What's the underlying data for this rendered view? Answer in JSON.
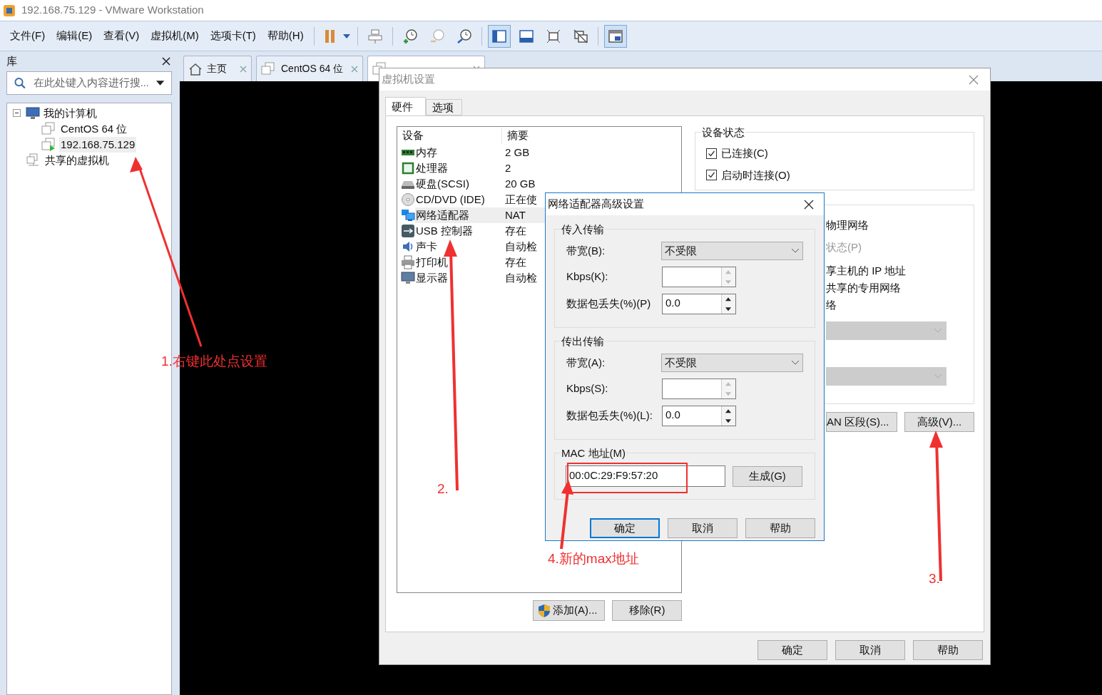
{
  "window": {
    "title": "192.168.75.129 - VMware Workstation"
  },
  "menu": [
    {
      "label": "文件(F)"
    },
    {
      "label": "编辑(E)"
    },
    {
      "label": "查看(V)"
    },
    {
      "label": "虚拟机(M)"
    },
    {
      "label": "选项卡(T)"
    },
    {
      "label": "帮助(H)"
    }
  ],
  "library": {
    "title": "库",
    "search": {
      "placeholder": "在此处键入内容进行搜..."
    },
    "tree": [
      {
        "label": "我的计算机",
        "kind": "computer",
        "expanded": true,
        "selected": false,
        "children": [
          {
            "label": "CentOS 64 位",
            "kind": "vm",
            "running": false,
            "selected": false
          },
          {
            "label": "192.168.75.129",
            "kind": "vm",
            "running": true,
            "selected": true
          }
        ]
      },
      {
        "label": "共享的虚拟机",
        "kind": "shared",
        "selected": false
      }
    ]
  },
  "tabs": [
    {
      "label": "主页",
      "kind": "home",
      "selected": false
    },
    {
      "label": "CentOS 64 位",
      "kind": "vm",
      "selected": false
    },
    {
      "kind": "vm",
      "selected": true
    }
  ],
  "settings_dialog": {
    "title": "虚拟机设置",
    "tabs": [
      {
        "label": "硬件",
        "selected": true
      },
      {
        "label": "选项",
        "selected": false
      }
    ],
    "devices": {
      "columns": [
        "设备",
        "摘要"
      ],
      "rows": [
        {
          "device": "内存",
          "summary": "2 GB",
          "kind": "memory",
          "selected": false
        },
        {
          "device": "处理器",
          "summary": "2",
          "kind": "cpu",
          "selected": false
        },
        {
          "device": "硬盘(SCSI)",
          "summary": "20 GB",
          "kind": "disk",
          "selected": false
        },
        {
          "device": "CD/DVD (IDE)",
          "summary": "正在使",
          "kind": "cd",
          "selected": false
        },
        {
          "device": "网络适配器",
          "summary": "NAT",
          "kind": "network",
          "selected": true
        },
        {
          "device": "USB 控制器",
          "summary": "存在",
          "kind": "usb",
          "selected": false
        },
        {
          "device": "声卡",
          "summary": "自动检",
          "kind": "sound",
          "selected": false
        },
        {
          "device": "打印机",
          "summary": "存在",
          "kind": "printer",
          "selected": false
        },
        {
          "device": "显示器",
          "summary": "自动检",
          "kind": "display",
          "selected": false
        }
      ]
    },
    "list_buttons": [
      "添加(A)...",
      "移除(R)"
    ],
    "device_status": {
      "title": "设备状态",
      "options": [
        {
          "label": "已连接(C)",
          "checked": true
        },
        {
          "label": "启动时连接(O)",
          "checked": true
        }
      ]
    },
    "network_connection": {
      "lines": [
        {
          "text": "物理网络",
          "disabled": false
        },
        {
          "text": "状态(P)",
          "disabled": true
        },
        {
          "text": "享主机的 IP 地址",
          "disabled": false
        },
        {
          "text": "共享的专用网络",
          "disabled": false
        },
        {
          "text": "络",
          "disabled": false
        }
      ],
      "dropdowns": [
        {
          "disabled": true
        },
        {
          "disabled": true
        }
      ]
    },
    "side_buttons": [
      "AN 区段(S)...",
      "高级(V)..."
    ],
    "footer_buttons": [
      "确定",
      "取消",
      "帮助"
    ]
  },
  "network_dialog": {
    "title": "网络适配器高级设置",
    "groups": [
      {
        "title": "传入传输",
        "bandwidth": {
          "label": "带宽(B):",
          "value": "不受限"
        },
        "kbps": {
          "label": "Kbps(K):",
          "disabled": true
        },
        "loss": {
          "label": "数据包丢失(%)(P)",
          "value": "0.0",
          "disabled": false
        }
      },
      {
        "title": "传出传输",
        "bandwidth": {
          "label": "带宽(A):",
          "value": "不受限"
        },
        "kbps": {
          "label": "Kbps(S):",
          "disabled": true
        },
        "loss": {
          "label": "数据包丢失(%)(L):",
          "value": "0.0",
          "disabled": false
        }
      }
    ],
    "mac": {
      "title": "MAC 地址(M)",
      "value": "00:0C:29:F9:57:20",
      "button": "生成(G)"
    },
    "buttons": [
      {
        "label": "确定",
        "default": true
      },
      {
        "label": "取消",
        "default": false
      },
      {
        "label": "帮助",
        "default": false
      }
    ]
  },
  "annotations": [
    {
      "text": "1.右键此处点设置"
    },
    {
      "text": "2."
    },
    {
      "text": "3."
    },
    {
      "text": "4.新的max地址"
    }
  ]
}
